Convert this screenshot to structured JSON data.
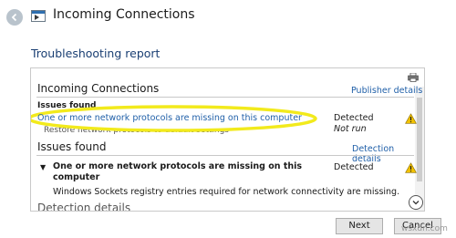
{
  "window": {
    "title": "Incoming Connections"
  },
  "page": {
    "subheading": "Troubleshooting report"
  },
  "report": {
    "section1": {
      "title": "Incoming Connections",
      "link": "Publisher details",
      "issues_label": "Issues found",
      "issue_text": "One or more network protocols are missing on this computer",
      "issue_status": "Detected",
      "sub_text": "Restore network protocols to default settings",
      "sub_status": "Not run"
    },
    "section2": {
      "title": "Issues found",
      "link": "Detection details",
      "issue_title": "One or more network protocols are missing on this computer",
      "issue_status": "Detected",
      "description": "Windows Sockets registry entries required for network connectivity are missing."
    },
    "section3": {
      "title": "Detection details"
    }
  },
  "buttons": {
    "next": "Next",
    "cancel": "Cancel"
  },
  "watermark": "wsxdn.com",
  "colors": {
    "accent": "#1f5fa8",
    "heading": "#1a3f73",
    "highlight": "#f2ea1c",
    "warning": "#f2c200"
  },
  "icons": {
    "back": "back-arrow-icon",
    "app": "network-troubleshooter-icon",
    "print": "printer-icon",
    "warning": "warning-icon",
    "expand": "chevron-down-icon"
  }
}
